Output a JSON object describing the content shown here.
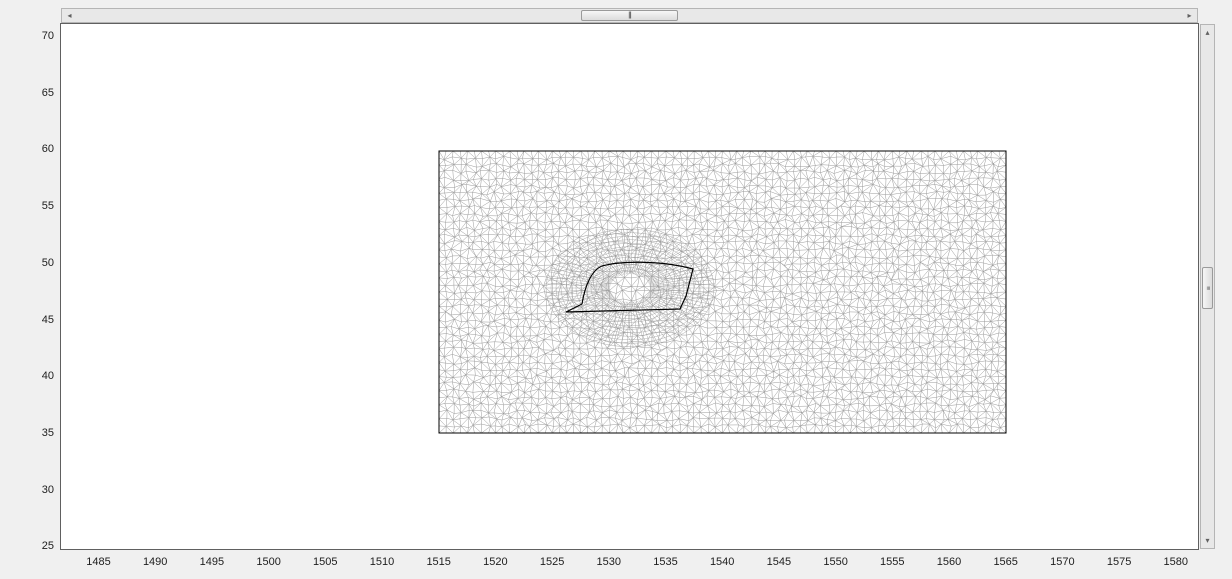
{
  "scrollbars": {
    "horizontal": {
      "left_arrow": "◂",
      "right_arrow": "▸",
      "grip": "|||"
    },
    "vertical": {
      "up_arrow": "▴",
      "down_arrow": "▾",
      "grip": "≡"
    }
  },
  "axes": {
    "x_ticks": [
      "1485",
      "1490",
      "1495",
      "1500",
      "1505",
      "1510",
      "1515",
      "1520",
      "1525",
      "1530",
      "1535",
      "1540",
      "1545",
      "1550",
      "1555",
      "1560",
      "1565",
      "1570",
      "1575",
      "1580"
    ],
    "y_ticks": [
      "70",
      "65",
      "60",
      "55",
      "50",
      "45",
      "40",
      "35",
      "30",
      "25"
    ]
  },
  "colors": {
    "mesh": "#9a9a9a",
    "outline": "#000000",
    "plot_bg": "#ffffff"
  }
}
